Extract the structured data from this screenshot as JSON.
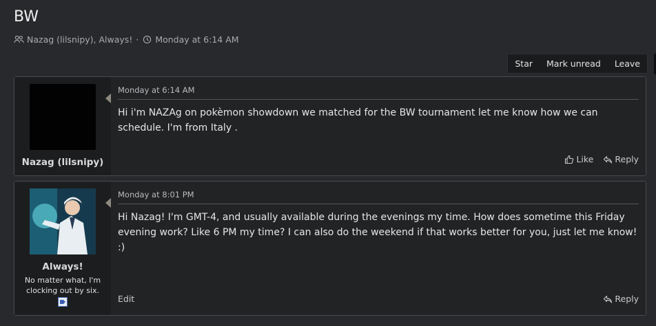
{
  "thread": {
    "title": "BW",
    "participants": "Nazag (lilsnipy), Always!",
    "separator": "·",
    "start_time": "Monday at 6:14 AM"
  },
  "actions": {
    "star": "Star",
    "mark_unread": "Mark unread",
    "leave": "Leave"
  },
  "messages": [
    {
      "username": "Nazag (lilsnipy)",
      "date": "Monday at 6:14 AM",
      "text": "Hi i'm NAZAg on pokèmon showdown we matched for the BW tournament let me know how we can schedule. I'm from Italy .",
      "like": "Like",
      "reply": "Reply"
    },
    {
      "username": "Always!",
      "tagline": "No matter what, I'm clocking out by six.",
      "date": "Monday at 8:01 PM",
      "text": "Hi Nazag! I'm GMT-4, and usually available during the evenings my time. How does sometime this Friday evening work? Like 6 PM my time? I can also do the weekend if that works better for you, just let me know! :)",
      "edit": "Edit",
      "reply": "Reply"
    }
  ],
  "icons": {
    "participants": "users-icon",
    "time": "clock-icon",
    "like": "thumbs-up-icon",
    "reply": "reply-icon"
  }
}
